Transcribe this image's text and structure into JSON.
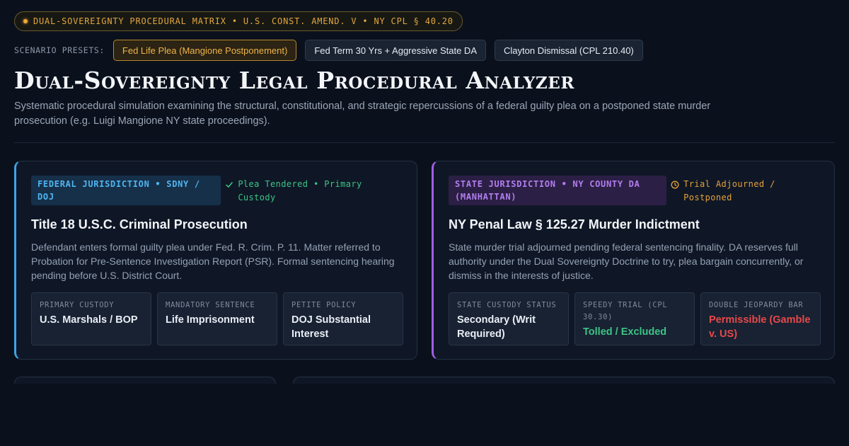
{
  "header": {
    "matrix_label": "DUAL-SOVEREIGNTY PROCEDURAL MATRIX • U.S. CONST. AMEND. V • NY CPL § 40.20",
    "presets_label": "SCENARIO PRESETS:",
    "presets": [
      {
        "label": "Fed Life Plea (Mangione Postponement)",
        "active": true
      },
      {
        "label": "Fed Term 30 Yrs + Aggressive State DA",
        "active": false
      },
      {
        "label": "Clayton Dismissal (CPL 210.40)",
        "active": false
      }
    ],
    "title": "Dual-Sovereignty Legal Procedural Analyzer",
    "subtitle": "Systematic procedural simulation examining the structural, constitutional, and strategic repercussions of a federal guilty plea on a postponed state murder prosecution (e.g. Luigi Mangione NY state proceedings)."
  },
  "federal": {
    "jurisdiction": "FEDERAL JURISDICTION • SDNY / DOJ",
    "status": "Plea Tendered • Primary Custody",
    "status_icon": "check-icon",
    "title": "Title 18 U.S.C. Criminal Prosecution",
    "body": "Defendant enters formal guilty plea under Fed. R. Crim. P. 11. Matter referred to Probation for Pre-Sentence Investigation Report (PSR). Formal sentencing hearing pending before U.S. District Court.",
    "stats": [
      {
        "label": "PRIMARY CUSTODY",
        "value": "U.S. Marshals / BOP",
        "tone": "default"
      },
      {
        "label": "MANDATORY SENTENCE",
        "value": "Life Imprisonment",
        "tone": "default"
      },
      {
        "label": "PETITE POLICY",
        "value": "DOJ Substantial Interest",
        "tone": "default"
      }
    ],
    "accent": "#3aa6e6"
  },
  "state": {
    "jurisdiction": "STATE JURISDICTION • NY COUNTY DA (MANHATTAN)",
    "status": "Trial Adjourned / Postponed",
    "status_icon": "clock-icon",
    "title": "NY Penal Law § 125.27 Murder Indictment",
    "body": "State murder trial adjourned pending federal sentencing finality. DA reserves full authority under the Dual Sovereignty Doctrine to try, plea bargain concurrently, or dismiss in the interests of justice.",
    "stats": [
      {
        "label": "STATE CUSTODY STATUS",
        "value": "Secondary (Writ Required)",
        "tone": "default"
      },
      {
        "label": "SPEEDY TRIAL (CPL 30.30)",
        "value": "Tolled / Excluded",
        "tone": "green"
      },
      {
        "label": "DOUBLE JEOPARDY BAR",
        "value": "Permissible (Gamble v. US)",
        "tone": "red"
      }
    ],
    "accent": "#a25ee6"
  }
}
